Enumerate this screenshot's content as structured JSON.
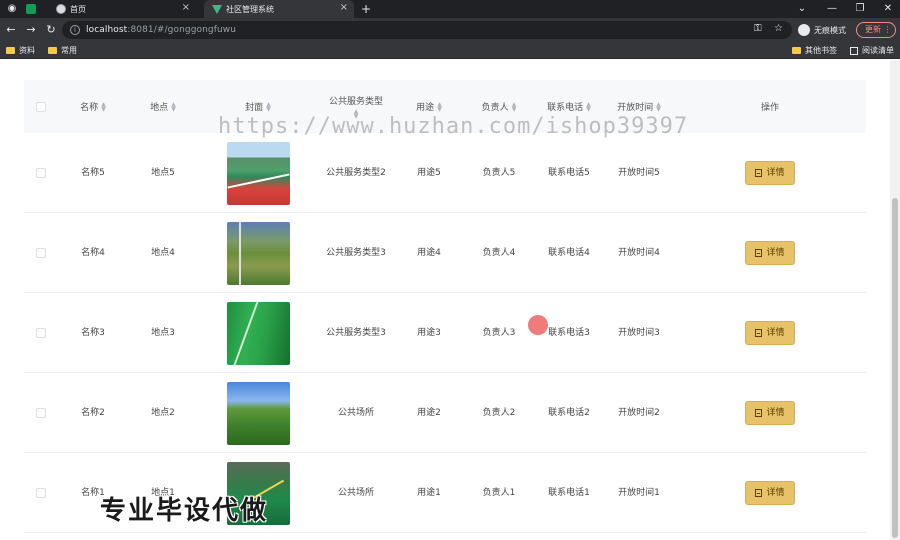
{
  "browser": {
    "tabs": [
      {
        "title": "",
        "icon": "sheet-icon"
      },
      {
        "title": "首页",
        "icon": "globe-icon"
      },
      {
        "title": "社区管理系统",
        "icon": "vue-icon",
        "active": true
      }
    ],
    "new_tab": "+",
    "url_host": "localhost",
    "url_rest": ":8081/#/gonggongfuwu",
    "profile_label": "无痕模式",
    "update_label": "更新",
    "bookmarks": [
      "资料",
      "常用"
    ],
    "other_bookmarks": "其他书签",
    "reading_list": "阅读清单"
  },
  "table": {
    "columns": [
      "名称",
      "地点",
      "封面",
      "公共服务类型",
      "用途",
      "负责人",
      "联系电话",
      "开放时间",
      "操作"
    ],
    "action_label": "详情",
    "rows": [
      {
        "name": "名称5",
        "location": "地点5",
        "cover": "court",
        "type": "公共服务类型2",
        "purpose": "用途5",
        "manager": "负责人5",
        "phone": "联系电话5",
        "hours": "开放时间5"
      },
      {
        "name": "名称4",
        "location": "地点4",
        "cover": "field",
        "type": "公共服务类型3",
        "purpose": "用途4",
        "manager": "负责人4",
        "phone": "联系电话4",
        "hours": "开放时间4"
      },
      {
        "name": "名称3",
        "location": "地点3",
        "cover": "track",
        "type": "公共服务类型3",
        "purpose": "用途3",
        "manager": "负责人3",
        "phone": "联系电话3",
        "hours": "开放时间3"
      },
      {
        "name": "名称2",
        "location": "地点2",
        "cover": "lawn",
        "type": "公共场所",
        "purpose": "用途2",
        "manager": "负责人2",
        "phone": "联系电话2",
        "hours": "开放时间2"
      },
      {
        "name": "名称1",
        "location": "地点1",
        "cover": "gym",
        "type": "公共场所",
        "purpose": "用途1",
        "manager": "负责人1",
        "phone": "联系电话1",
        "hours": "开放时间1"
      }
    ]
  },
  "overlays": {
    "watermark_url": "https://www.huzhan.com/ishop39397",
    "banner": "专业毕设代做"
  },
  "colors": {
    "detail_button": "#e8c26a",
    "header_bg": "#f7f8fa"
  }
}
